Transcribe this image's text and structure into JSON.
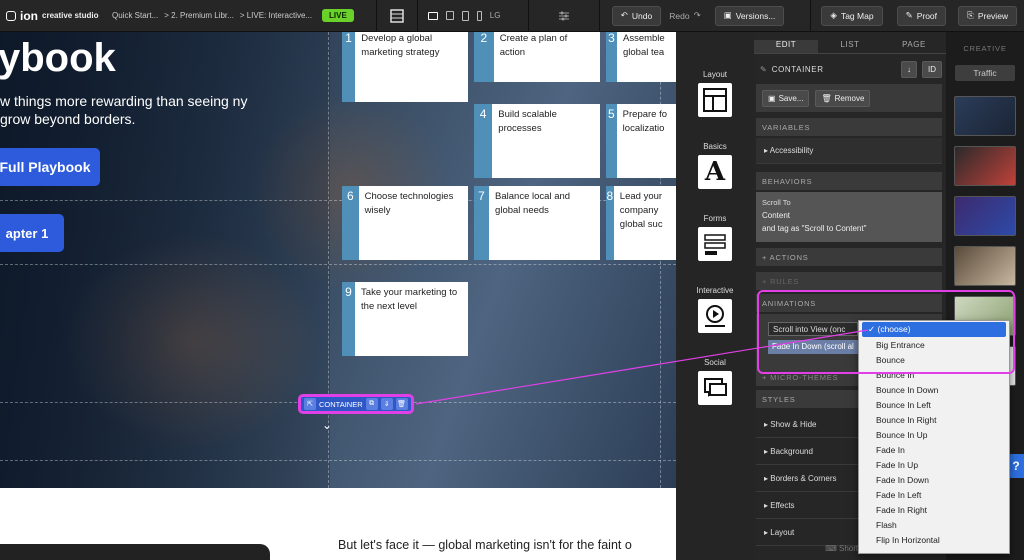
{
  "topbar": {
    "logo_text": "ion",
    "logo_sub": "creative studio",
    "breadcrumbs": [
      "Quick Start...",
      "> 2. Premium Libr...",
      "> LIVE: Interactive..."
    ],
    "live_badge": "LIVE",
    "device_label": "LG",
    "undo_label": "Undo",
    "redo_label": "Redo",
    "versions_label": "Versions...",
    "tagmap_label": "Tag Map",
    "proof_label": "Proof",
    "preview_label": "Preview"
  },
  "canvas": {
    "hero_title": "ybook",
    "hero_sub": "w things more rewarding than seeing ny grow beyond borders.",
    "cta_primary": "Full Playbook",
    "cta_secondary": "apter 1",
    "steps": [
      {
        "num": "1",
        "text": "Develop a global marketing strategy"
      },
      {
        "num": "2",
        "text": "Create a plan of action"
      },
      {
        "num": "3",
        "text": "Assemble global tea"
      },
      {
        "num": "4",
        "text": "Build scalable processes"
      },
      {
        "num": "5",
        "text": "Prepare fo localizatio"
      },
      {
        "num": "6",
        "text": "Choose technologies wisely"
      },
      {
        "num": "7",
        "text": "Balance local and global needs"
      },
      {
        "num": "8",
        "text": "Lead your company global suc"
      },
      {
        "num": "9",
        "text": "Take your marketing to the next level"
      }
    ],
    "container_label": "CONTAINER",
    "lower_text": "But let's face it — global marketing isn't for the faint o"
  },
  "widgets": [
    {
      "label": "Layout",
      "icon": "layout-icon"
    },
    {
      "label": "Basics",
      "icon": "text-icon"
    },
    {
      "label": "Forms",
      "icon": "form-icon"
    },
    {
      "label": "Interactive",
      "icon": "video-icon"
    },
    {
      "label": "Social",
      "icon": "chat-icon"
    }
  ],
  "props": {
    "tabs": [
      "EDIT",
      "LIST",
      "PAGE"
    ],
    "title": "CONTAINER",
    "id_label": "ID",
    "save_label": "Save...",
    "remove_label": "Remove",
    "variables_header": "VARIABLES",
    "accessibility_label": "Accessibility",
    "behaviors_header": "BEHAVIORS",
    "behavior_line1": "Scroll To",
    "behavior_line2": "Content",
    "behavior_line3": "and tag as \"Scroll to Content\"",
    "actions_label": "+ ACTIONS",
    "rules_label": "+ RULES",
    "animations_header": "ANIMATIONS",
    "anim_trigger": "Scroll into View (onc",
    "anim_effect": "Fade In Down (scroll al",
    "micro_label": "+ MICRO-THEMES",
    "styles_header": "STYLES",
    "style_items": [
      "Show & Hide",
      "Background",
      "Borders & Corners",
      "Effects",
      "Layout"
    ],
    "shortcuts_label": "Shortcuts"
  },
  "dropdown": {
    "options": [
      "(choose)",
      "Big Entrance",
      "Bounce",
      "Bounce In",
      "Bounce In Down",
      "Bounce In Left",
      "Bounce In Right",
      "Bounce In Up",
      "Fade In",
      "Fade In Up",
      "Fade In Down",
      "Fade In Left",
      "Fade In Right",
      "Flash",
      "Flip In Horizontal"
    ],
    "selected": "(choose)"
  },
  "creative": {
    "header": "CREATIVE",
    "traffic_label": "Traffic"
  },
  "colors": {
    "accent": "#2d5bdc",
    "highlight": "#e040e6",
    "live": "#6ad02a",
    "step_bar": "#4f8fb8"
  }
}
